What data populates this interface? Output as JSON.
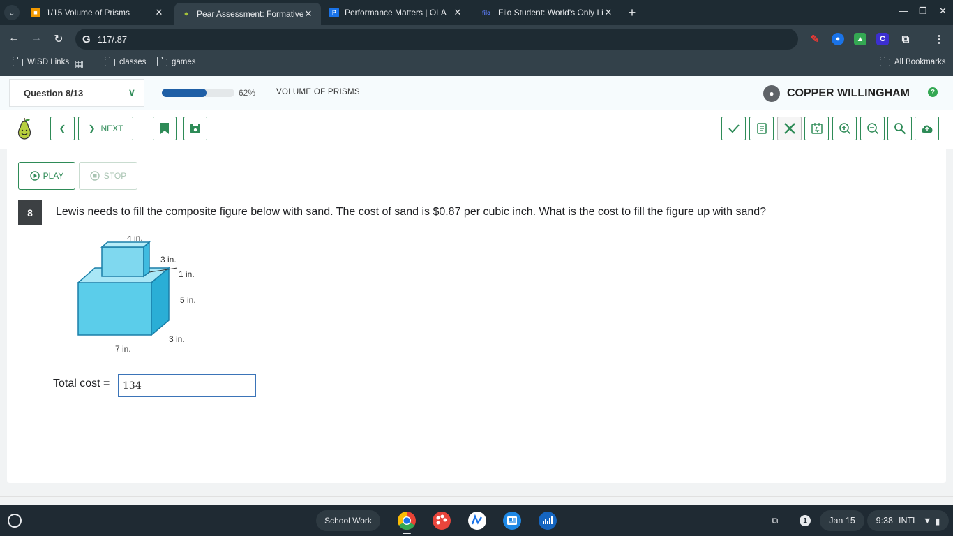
{
  "browser": {
    "tabs": [
      {
        "title": "1/15 Volume of Prisms",
        "favicon": "classroom-icon",
        "color": "#f29900"
      },
      {
        "title": "Pear Assessment: Formative a",
        "favicon": "pear-icon",
        "color": "#a3c23a"
      },
      {
        "title": "Performance Matters | OLA",
        "favicon": "p-icon",
        "color": "#1a73e8"
      },
      {
        "title": "Filo Student: World's Only Live I",
        "favicon": "filo-icon",
        "color": "#3b5bdb"
      }
    ],
    "favicon_letters": {
      "p": "P",
      "filo": "filo"
    },
    "url": "117/.87",
    "bookmarks": {
      "wisd": "WISD Links",
      "classes": "classes",
      "games": "games",
      "all": "All Bookmarks"
    }
  },
  "app": {
    "question_select": "Question 8/13",
    "progress_percent": 62,
    "progress_label": "62%",
    "topic": "VOLUME OF PRISMS",
    "user_name": "COPPER WILLINGHAM",
    "help_glyph": "?",
    "next_label": "NEXT",
    "play_label": "PLAY",
    "stop_label": "STOP",
    "question_number": "8",
    "question_text": "Lewis needs to fill the composite figure below with sand. The cost of sand is $0.87 per cubic inch. What is the cost to fill the figure up with sand?",
    "figure_labels": {
      "top_width": "4 in.",
      "top_depth": "3 in.",
      "offset": "1 in.",
      "bottom_height": "5 in.",
      "bottom_depth": "3 in.",
      "bottom_width": "7 in."
    },
    "answer_label": "Total cost =",
    "answer_value": "134"
  },
  "shelf": {
    "desk_label": "School Work",
    "notif_count": "1",
    "date": "Jan 15",
    "time": "9:38",
    "locale": "INTL"
  },
  "colors": {
    "accent_green": "#2e8b57",
    "progress_blue": "#1f5fa6",
    "chrome_dark": "#1e2b33"
  }
}
